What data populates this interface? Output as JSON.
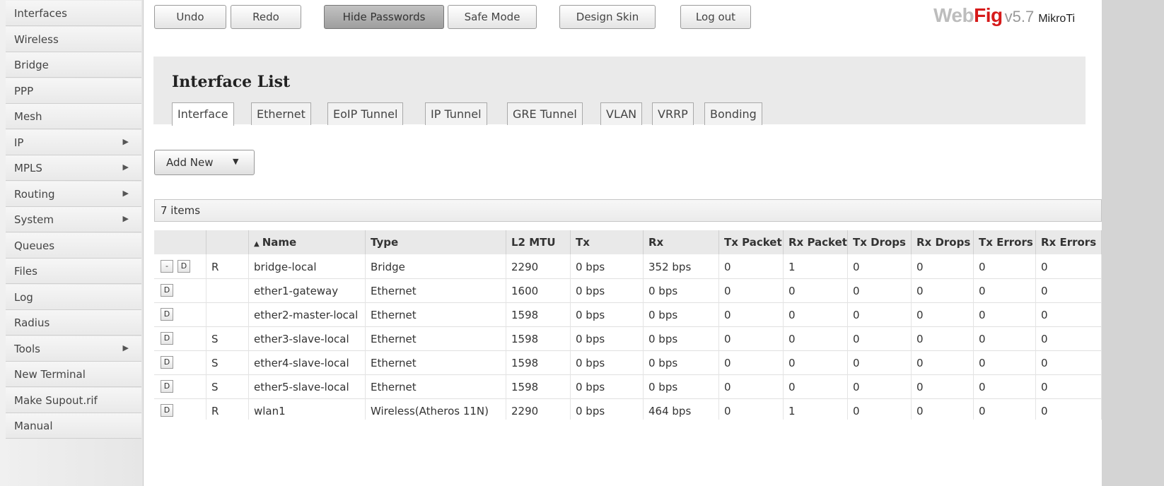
{
  "sidebar": {
    "items": [
      {
        "label": "Interfaces",
        "has_arrow": false
      },
      {
        "label": "Wireless",
        "has_arrow": false
      },
      {
        "label": "Bridge",
        "has_arrow": false
      },
      {
        "label": "PPP",
        "has_arrow": false
      },
      {
        "label": "Mesh",
        "has_arrow": false
      },
      {
        "label": "IP",
        "has_arrow": true
      },
      {
        "label": "MPLS",
        "has_arrow": true
      },
      {
        "label": "Routing",
        "has_arrow": true
      },
      {
        "label": "System",
        "has_arrow": true
      },
      {
        "label": "Queues",
        "has_arrow": false
      },
      {
        "label": "Files",
        "has_arrow": false
      },
      {
        "label": "Log",
        "has_arrow": false
      },
      {
        "label": "Radius",
        "has_arrow": false
      },
      {
        "label": "Tools",
        "has_arrow": true
      },
      {
        "label": "New Terminal",
        "has_arrow": false
      },
      {
        "label": "Make Supout.rif",
        "has_arrow": false
      },
      {
        "label": "Manual",
        "has_arrow": false
      }
    ],
    "arrow_icon": "▶"
  },
  "toolbar": {
    "undo": "Undo",
    "redo": "Redo",
    "hide_passwords": "Hide Passwords",
    "safe_mode": "Safe Mode",
    "design_skin": "Design Skin",
    "log_out": "Log out"
  },
  "logo": {
    "web": "Web",
    "fig": "Fig",
    "version": "v5.7",
    "brand": "MikroTi"
  },
  "page": {
    "title": "Interface List",
    "tabs": [
      "Interface",
      "Ethernet",
      "EoIP Tunnel",
      "IP Tunnel",
      "GRE Tunnel",
      "VLAN",
      "VRRP",
      "Bonding"
    ],
    "active_tab": "Interface",
    "add_new": "Add New",
    "add_new_icon": "▼",
    "items_count": "7 items"
  },
  "table": {
    "sort_icon": "▲",
    "columns": [
      "",
      "",
      "Name",
      "Type",
      "L2 MTU",
      "Tx",
      "Rx",
      "Tx Packet",
      "Rx Packet",
      "Tx Drops",
      "Rx Drops",
      "Tx Errors",
      "Rx Errors"
    ],
    "rows": [
      {
        "buttons": [
          "-",
          "D"
        ],
        "flag": "R",
        "name": "bridge-local",
        "type": "Bridge",
        "l2mtu": "2290",
        "tx": "0 bps",
        "rx": "352 bps",
        "txp": "0",
        "rxp": "1",
        "txd": "0",
        "rxd": "0",
        "txe": "0",
        "rxe": "0"
      },
      {
        "buttons": [
          "D"
        ],
        "flag": "",
        "name": "ether1-gateway",
        "type": "Ethernet",
        "l2mtu": "1600",
        "tx": "0 bps",
        "rx": "0 bps",
        "txp": "0",
        "rxp": "0",
        "txd": "0",
        "rxd": "0",
        "txe": "0",
        "rxe": "0"
      },
      {
        "buttons": [
          "D"
        ],
        "flag": "",
        "name": "ether2-master-local",
        "type": "Ethernet",
        "l2mtu": "1598",
        "tx": "0 bps",
        "rx": "0 bps",
        "txp": "0",
        "rxp": "0",
        "txd": "0",
        "rxd": "0",
        "txe": "0",
        "rxe": "0"
      },
      {
        "buttons": [
          "D"
        ],
        "flag": "S",
        "name": "ether3-slave-local",
        "type": "Ethernet",
        "l2mtu": "1598",
        "tx": "0 bps",
        "rx": "0 bps",
        "txp": "0",
        "rxp": "0",
        "txd": "0",
        "rxd": "0",
        "txe": "0",
        "rxe": "0"
      },
      {
        "buttons": [
          "D"
        ],
        "flag": "S",
        "name": "ether4-slave-local",
        "type": "Ethernet",
        "l2mtu": "1598",
        "tx": "0 bps",
        "rx": "0 bps",
        "txp": "0",
        "rxp": "0",
        "txd": "0",
        "rxd": "0",
        "txe": "0",
        "rxe": "0"
      },
      {
        "buttons": [
          "D"
        ],
        "flag": "S",
        "name": "ether5-slave-local",
        "type": "Ethernet",
        "l2mtu": "1598",
        "tx": "0 bps",
        "rx": "0 bps",
        "txp": "0",
        "rxp": "0",
        "txd": "0",
        "rxd": "0",
        "txe": "0",
        "rxe": "0"
      },
      {
        "buttons": [
          "D"
        ],
        "flag": "R",
        "name": "wlan1",
        "type": "Wireless(Atheros 11N)",
        "l2mtu": "2290",
        "tx": "0 bps",
        "rx": "464 bps",
        "txp": "0",
        "rxp": "1",
        "txd": "0",
        "rxd": "0",
        "txe": "0",
        "rxe": "0"
      }
    ]
  }
}
